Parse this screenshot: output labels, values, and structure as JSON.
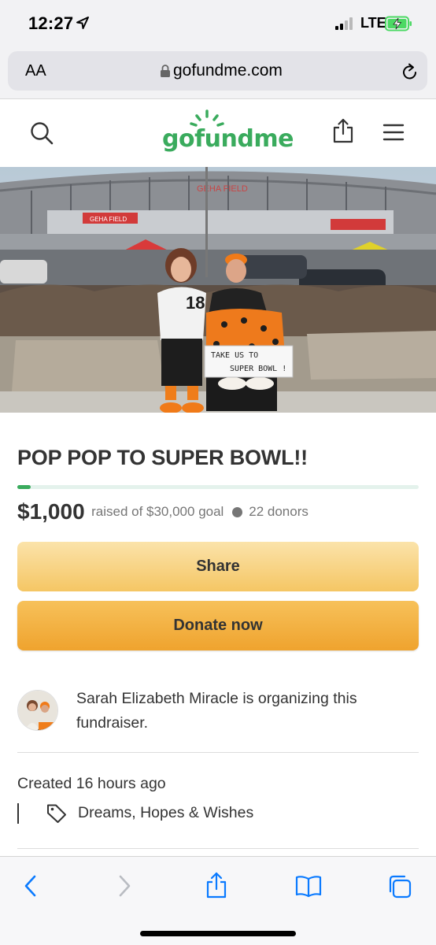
{
  "status_bar": {
    "time": "12:27",
    "network": "LTE"
  },
  "browser": {
    "text_size_label": "AA",
    "url": "gofundme.com"
  },
  "site": {
    "logo_text": "gofundme"
  },
  "hero_image": {
    "description": "Two people in Bengals gear outside a stadium",
    "stadium_sign": "GEHA FIELD",
    "sign_text_line1": "TAKE US TO",
    "sign_text_line2": "SUPER BOWL !",
    "jersey_number": "18"
  },
  "campaign": {
    "title": "POP POP TO SUPER BOWL!!",
    "raised": "$1,000",
    "goal_text": "raised of $30,000 goal",
    "donors": "22 donors",
    "progress_fraction": 0.033
  },
  "buttons": {
    "share": "Share",
    "donate": "Donate now"
  },
  "organizer": {
    "text": "Sarah Elizabeth Miracle is organizing this fundraiser."
  },
  "meta": {
    "created": "Created 16 hours ago",
    "category": "Dreams, Hopes & Wishes"
  },
  "colors": {
    "brand_green": "#3aab5d",
    "share_button": "#f8d68a",
    "donate_button": "#f3b445",
    "ios_blue": "#0a7aff"
  }
}
